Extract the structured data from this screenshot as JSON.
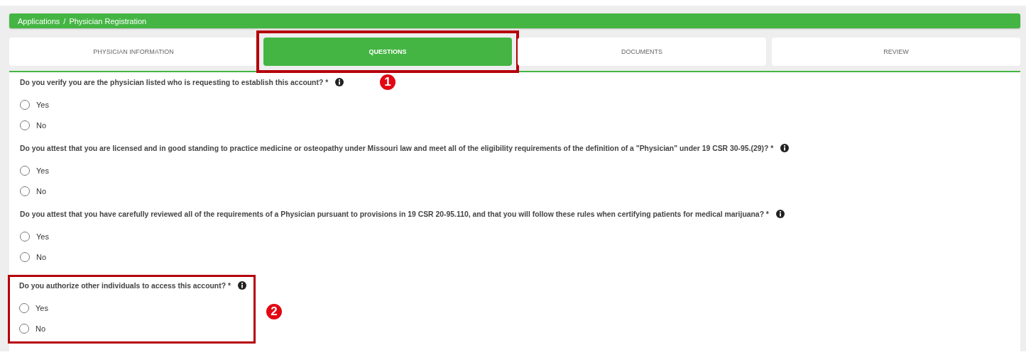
{
  "breadcrumb": [
    "Applications",
    "Physician Registration"
  ],
  "breadcrumb_separator": "/",
  "tabs": [
    {
      "label": "PHYSICIAN INFORMATION",
      "selected": false,
      "highlighted": false
    },
    {
      "label": "QUESTIONS",
      "selected": true,
      "highlighted": true,
      "callout": "1"
    },
    {
      "label": "DOCUMENTS",
      "selected": false,
      "highlighted": false
    },
    {
      "label": "REVIEW",
      "selected": false,
      "highlighted": false
    }
  ],
  "questions": [
    {
      "text": "Do you verify you are the physician listed who is requesting to establish this account? *",
      "highlighted": false,
      "options": [
        {
          "label": "Yes",
          "selected": false
        },
        {
          "label": "No",
          "selected": false
        }
      ]
    },
    {
      "text": "Do you attest that you are licensed and in good standing to practice medicine or osteopathy under Missouri law and meet all of the eligibility requirements of the definition of a \"Physician\" under 19 CSR 30-95.(29)? *",
      "highlighted": false,
      "options": [
        {
          "label": "Yes",
          "selected": false
        },
        {
          "label": "No",
          "selected": false
        }
      ]
    },
    {
      "text": "Do you attest that you have carefully reviewed all of the requirements of a Physician pursuant to provisions in 19 CSR 20-95.110, and that you will follow these rules when certifying patients for medical marijuana? *",
      "highlighted": false,
      "options": [
        {
          "label": "Yes",
          "selected": false
        },
        {
          "label": "No",
          "selected": false
        }
      ]
    },
    {
      "text": "Do you authorize other individuals to access this account? *",
      "highlighted": true,
      "callout": "2",
      "options": [
        {
          "label": "Yes",
          "selected": false
        },
        {
          "label": "No",
          "selected": false
        }
      ]
    }
  ]
}
